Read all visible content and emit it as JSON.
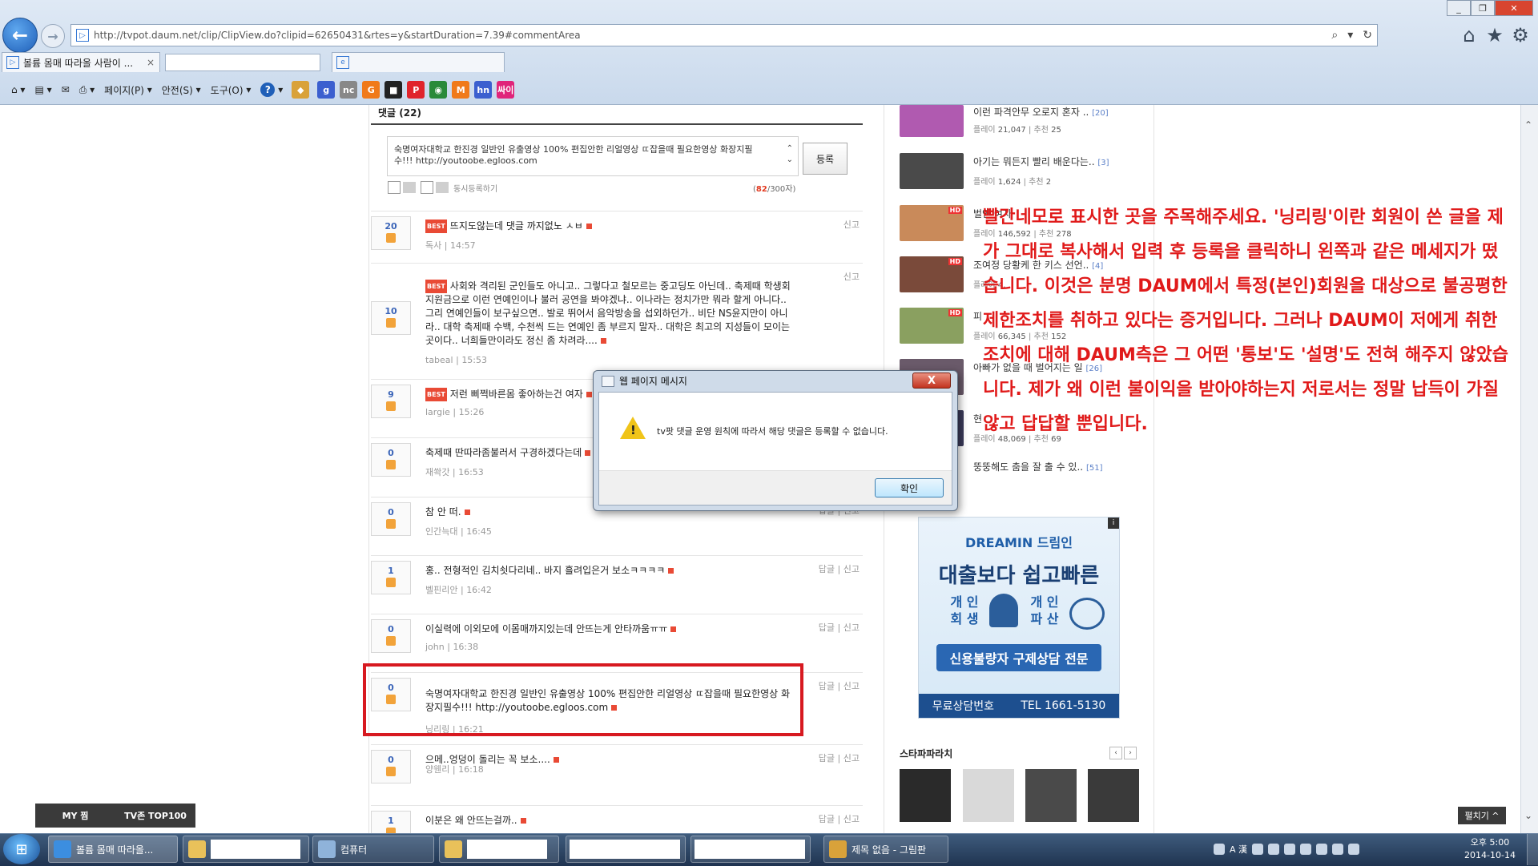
{
  "browser": {
    "url": "http://tvpot.daum.net/clip/ClipView.do?clipid=62650431&rtes=y&startDuration=7.39#commentArea",
    "tab_title": "볼륨 몸매 따라올 사람이 ...",
    "menu": {
      "page": "페이지(P)",
      "safety": "안전(S)",
      "tools": "도구(O)"
    },
    "toolbar_icons": [
      {
        "name": "g-icon",
        "label": "g",
        "color": "#3b5fcf"
      },
      {
        "name": "nc-icon",
        "label": "nc",
        "color": "#888888"
      },
      {
        "name": "g2-icon",
        "label": "G",
        "color": "#f07a1a"
      },
      {
        "name": "box-icon",
        "label": "■",
        "color": "#222222"
      },
      {
        "name": "p-icon",
        "label": "P",
        "color": "#e0242c"
      },
      {
        "name": "globe-icon",
        "label": "◉",
        "color": "#2a8a3a"
      },
      {
        "name": "m-icon",
        "label": "M",
        "color": "#f07a1a"
      },
      {
        "name": "hn-icon",
        "label": "hn",
        "color": "#3b5fcf"
      },
      {
        "name": "ssai-icon",
        "label": "싸이",
        "color": "#e0247a"
      }
    ]
  },
  "comments": {
    "header": "댓글 (22)",
    "input_text": "숙명여자대학교 한진경 일반인 유출영상 100% 편집안한 리얼영상 ㄸ잡을때 필요한영상 화장지필수!!! http://youtoobe.egloos.com",
    "submit_label": "등록",
    "sync_label": "동시등록하기",
    "char_count": "82",
    "char_max": "/300자)",
    "char_open": "(",
    "report": "신고",
    "reply": "답글",
    "best": "BEST",
    "items": [
      {
        "votes": "20",
        "best": true,
        "text": "뜨지도않는데 댓글 까지없노 ㅅㅂ",
        "author": "독사",
        "time": "14:57"
      },
      {
        "votes": "10",
        "best": true,
        "text": "사회와 격리된 군인들도 아니고.. 그렇다고 철모르는 중고딩도 아닌데.. 축제때 학생회 지원금으로 이런 연예인이나 불러 공연을 봐야겠냐.. 이나라는 정치가만 뭐라 할게 아니다.. 그리 연예인들이 보구싶으면.. 발로 뛰어서 음악방송을 섭외하던가.. 비단 NS윤지만이 아니라.. 대학 축제때 수백, 수천씩 드는 연예인 좀 부르지 말자.. 대학은 최고의 지성들이 모이는 곳이다.. 너희들만이라도 정신 좀 차려라....",
        "author": "tabeal",
        "time": "15:53"
      },
      {
        "votes": "9",
        "best": true,
        "text": "저런 삐쩍바른몸 좋아하는건 여자",
        "author": "largie",
        "time": "15:26"
      },
      {
        "votes": "0",
        "best": false,
        "text": "축제때 딴따라좀불러서 구경하겠다는데",
        "author": "재쏵갓",
        "time": "16:53"
      },
      {
        "votes": "0",
        "best": false,
        "text": "참 안 떠.",
        "author": "인간늑대",
        "time": "16:45"
      },
      {
        "votes": "1",
        "best": false,
        "text": "홍.. 전형적인 김치쇳다리네.. 바지 흘려입은거 보소ㅋㅋㅋㅋ",
        "author": "벨핀리안",
        "time": "16:42"
      },
      {
        "votes": "0",
        "best": false,
        "text": "이실력에 이외모에 이몸매까지있는데 안뜨는게 안타까움ㅠㅠ",
        "author": "john",
        "time": "16:38"
      },
      {
        "votes": "0",
        "best": false,
        "text": "숙명여자대학교 한진경 일반인 유출영상 100% 편집안한 리얼영상 ㄸ잡을때 필요한영상 화장지필수!!! http://youtoobe.egloos.com",
        "author": "닝리링",
        "time": "16:21"
      },
      {
        "votes": "0",
        "best": false,
        "text": "으메..엉덩이 돌리는 꼭 보소....",
        "author": "양웬리",
        "time": "16:18"
      },
      {
        "votes": "1",
        "best": false,
        "text": "이분은 왜 안뜨는걸까..",
        "author": "",
        "time": ""
      }
    ]
  },
  "related": [
    {
      "title": "이런 파격안무 오로지 혼자 ..",
      "count": "[20]",
      "plays": "21,047",
      "recs": "25",
      "hd": false,
      "color": "#b05ab0"
    },
    {
      "title": "아기는 뭐든지 빨리 배운다는..",
      "count": "[3]",
      "plays": "1,624",
      "recs": "2",
      "hd": false,
      "color": "#4a4a4a"
    },
    {
      "title": "벌인 여자",
      "count": "",
      "plays": "146,592",
      "recs": "278",
      "hd": true,
      "color": "#c98a5a"
    },
    {
      "title": "조여정 당황케 한 키스 선언..",
      "count": "[4]",
      "plays": "4,",
      "recs": "",
      "hd": true,
      "color": "#7a4a3a"
    },
    {
      "title": "피",
      "count": "",
      "plays": "66,345",
      "recs": "152",
      "hd": true,
      "color": "#8aa060"
    },
    {
      "title": "아빠가 없을 때 벌어지는 일",
      "count": "[26]",
      "plays": "",
      "recs": "",
      "hd": false,
      "color": "#6a5a6a"
    },
    {
      "title": "현",
      "count": "",
      "plays": "48,069",
      "recs": "69",
      "hd": false,
      "color": "#3a3a5a"
    },
    {
      "title": "뚱뚱해도 춤을 잘 출 수 있..",
      "count": "[51]",
      "plays": "",
      "recs": "",
      "hd": false,
      "color": "#ffffff"
    }
  ],
  "related_labels": {
    "plays": "플레이",
    "recs": "추천"
  },
  "ad": {
    "brand": "DREAMIN 드림인",
    "headline": "대출보다 쉽고빠른",
    "left": "개 인\n회 생",
    "right": "개 인\n파 산",
    "cta": "신용불량자 구제상담 전문",
    "bar_left": "무료상담번호",
    "bar_right": "TEL 1661-5130"
  },
  "stars": {
    "title": "스타파파라치",
    "colors": [
      "#2a2a2a",
      "#d9d9d9",
      "#4a4a4a",
      "#3a3a3a"
    ]
  },
  "annotation": "빨간네모로 표시한 곳을 주목해주세요. '닝리링'이란 회원이 쓴 글을 제가 그대로 복사해서 입력 후 등록을 클릭하니 왼쪽과 같은 메세지가 떴습니다. 이것은 분명 DAUM에서 특정(본인)회원을 대상으로 불공평한 제한조치를 취하고 있다는 증거입니다. 그러나 DAUM이 저에게 취한 조치에 대해 DAUM측은 그 어떤 '통보'도 '설명'도 전혀 해주지 않았습니다. 제가 왜 이런 불이익을 받아야하는지 저로서는 정말 납득이 가질 않고 답답할 뿐입니다.",
  "dialog": {
    "title": "웹 페이지 메시지",
    "message": "tv팟 댓글 운영 원칙에 따라서 해당 댓글은 등록할 수 없습니다.",
    "ok": "확인",
    "close": "X"
  },
  "bottom_bar": {
    "my": "MY 찜",
    "top": "TV존 TOP100",
    "fold": "펼치기 ^"
  },
  "taskbar": {
    "ie_label": "볼륨 몸매 따라올...",
    "computer_label": "컴퓨터",
    "paint_label": "제목 없음 - 그림판",
    "time": "오후 5:00",
    "date": "2014-10-14",
    "ime": "A 漢"
  }
}
